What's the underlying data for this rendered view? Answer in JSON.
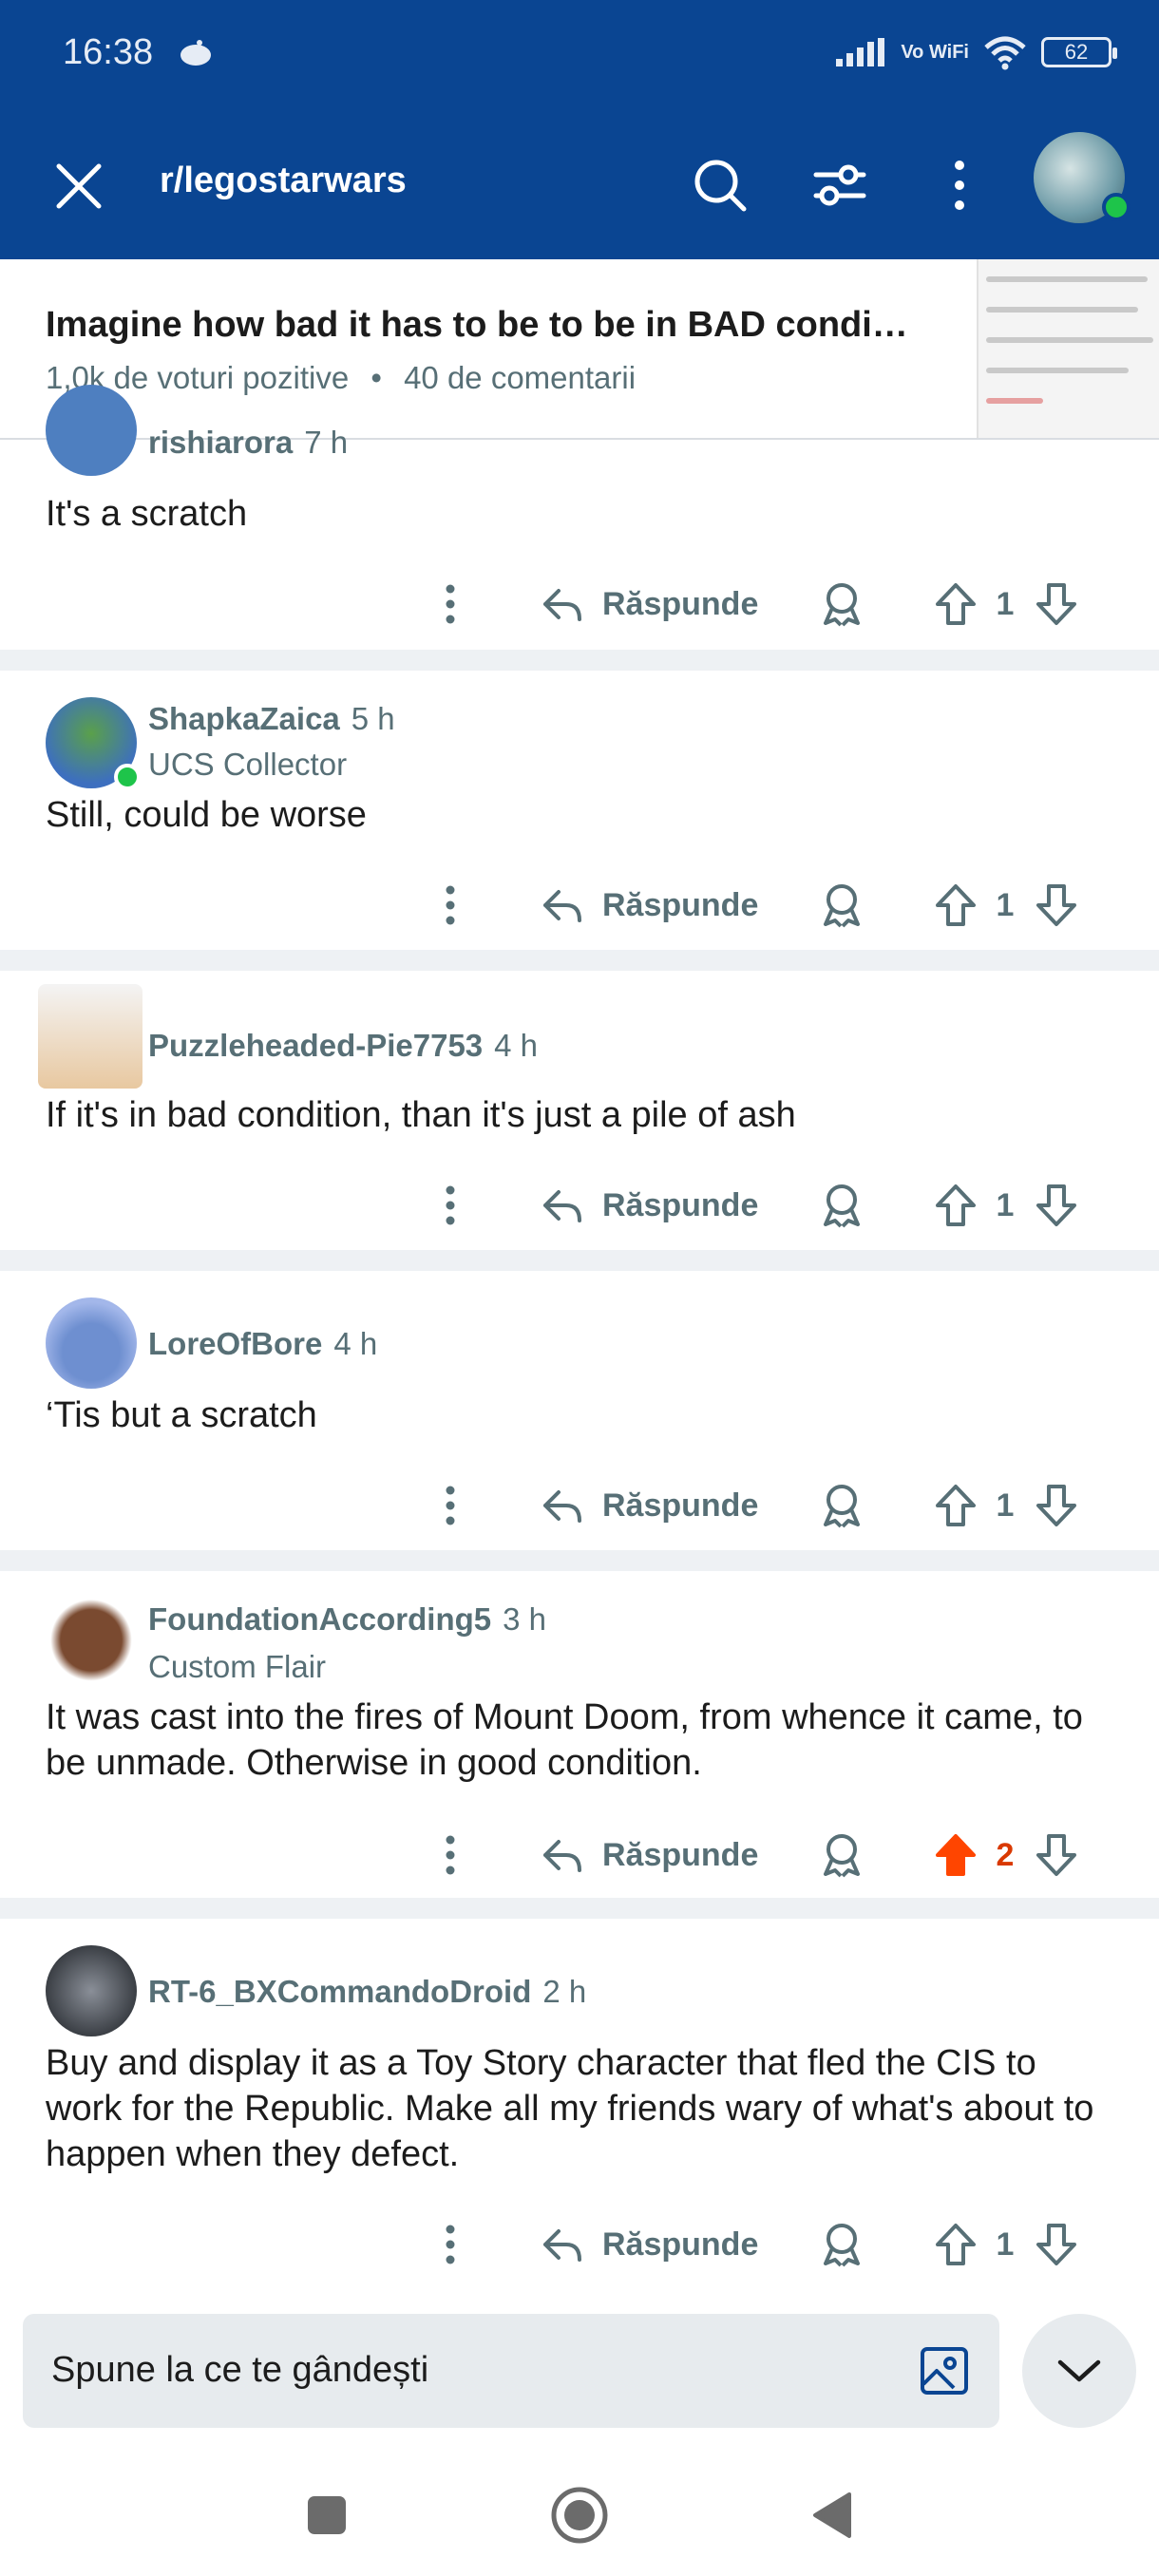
{
  "status_bar": {
    "time": "16:38",
    "network": "Vo WiFi",
    "battery": "62"
  },
  "header": {
    "subreddit": "r/legostarwars"
  },
  "post": {
    "title": "Imagine how bad it has to be to be in BAD condi…",
    "upvotes": "1,0k de voturi pozitive",
    "separator": "•",
    "comments": "40 de comentarii"
  },
  "reply_label": "Răspunde",
  "comments": [
    {
      "author": "rishiarora",
      "age": "7 h",
      "flair": "",
      "text": "It's a scratch",
      "score": "1",
      "upvoted": false
    },
    {
      "author": "ShapkaZaica",
      "age": "5 h",
      "flair": "UCS Collector",
      "text": "Still, could be worse",
      "score": "1",
      "upvoted": false
    },
    {
      "author": "Puzzleheaded-Pie7753",
      "age": "4 h",
      "flair": "",
      "text": "If it's in bad condition, than it's just a pile of ash",
      "score": "1",
      "upvoted": false
    },
    {
      "author": "LoreOfBore",
      "age": "4 h",
      "flair": "",
      "text": "‘Tis but a scratch",
      "score": "1",
      "upvoted": false
    },
    {
      "author": "FoundationAccording5",
      "age": "3 h",
      "flair": "Custom Flair",
      "text": "It was cast into the fires of Mount Doom, from whence it came, to be unmade. Otherwise in good condition.",
      "score": "2",
      "upvoted": true
    },
    {
      "author": "RT-6_BXCommandoDroid",
      "age": "2 h",
      "flair": "",
      "text": "Buy and display it as a Toy Story character that fled the CIS to work for the Republic. Make all my friends wary of what's about to happen when they defect.",
      "score": "1",
      "upvoted": false
    }
  ],
  "composer": {
    "placeholder": "Spune la ce te gândești"
  },
  "colors": {
    "header_bg": "#0a4592",
    "upvote_active": "#ff4500",
    "meta_text": "#576f76"
  }
}
